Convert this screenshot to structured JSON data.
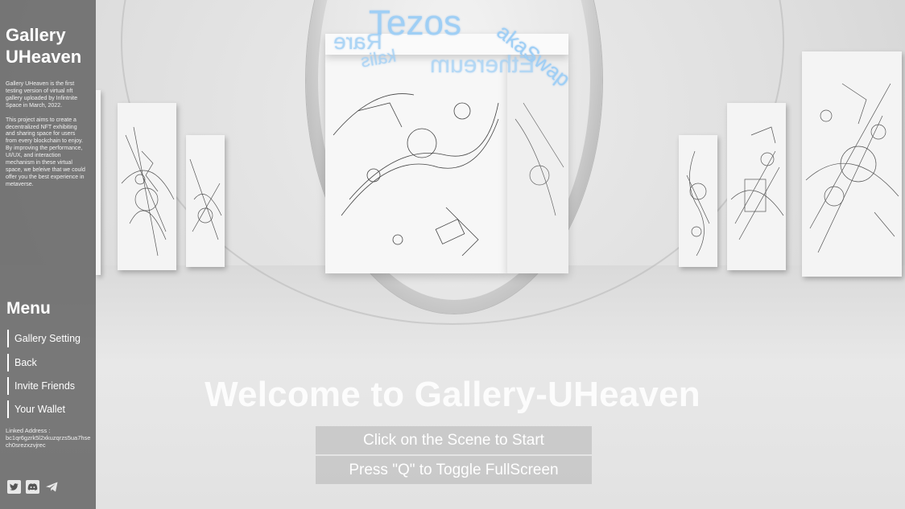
{
  "sidebar": {
    "title": "Gallery UHeaven",
    "description_1": "Gallery UHeaven is the first testing version of virtual nft gallery uploaded by Infintnite Space in March, 2022.",
    "description_2": "This project aims to create a decentralized NFT exhibiting and sharing space for users from every blockchain to enjoy. By improving the performance, UI/UX, and interaction mechanism in these virtual space, we beleive that we could offer you the best experience in metaverse.",
    "menu_title": "Menu",
    "menu_items": [
      {
        "label": "Gallery Setting"
      },
      {
        "label": "Back"
      },
      {
        "label": "Invite Friends"
      },
      {
        "label": "Your Wallet"
      }
    ],
    "linked_address_label": "Linked Address :",
    "linked_address_value": "bc1qr6gzrk5l2xkuzqrzs5ua7hsech0srezxzvjrec",
    "social_icons": [
      "twitter-icon",
      "discord-icon",
      "telegram-icon"
    ]
  },
  "scene": {
    "floating_labels": {
      "tezos": "Tezos",
      "ethereum": "Ethereum",
      "rare": "Rare",
      "akaswap": "akaSwap",
      "kalis": "kalis"
    }
  },
  "overlay": {
    "welcome": "Welcome to Gallery-UHeaven",
    "start_button": "Click on the Scene to Start",
    "fullscreen_button": "Press \"Q\" to Toggle FullScreen"
  },
  "colors": {
    "sidebar_bg": "#5f5f5f",
    "floating_text": "#9fcff5",
    "button_bg": "#b4b4b4"
  }
}
